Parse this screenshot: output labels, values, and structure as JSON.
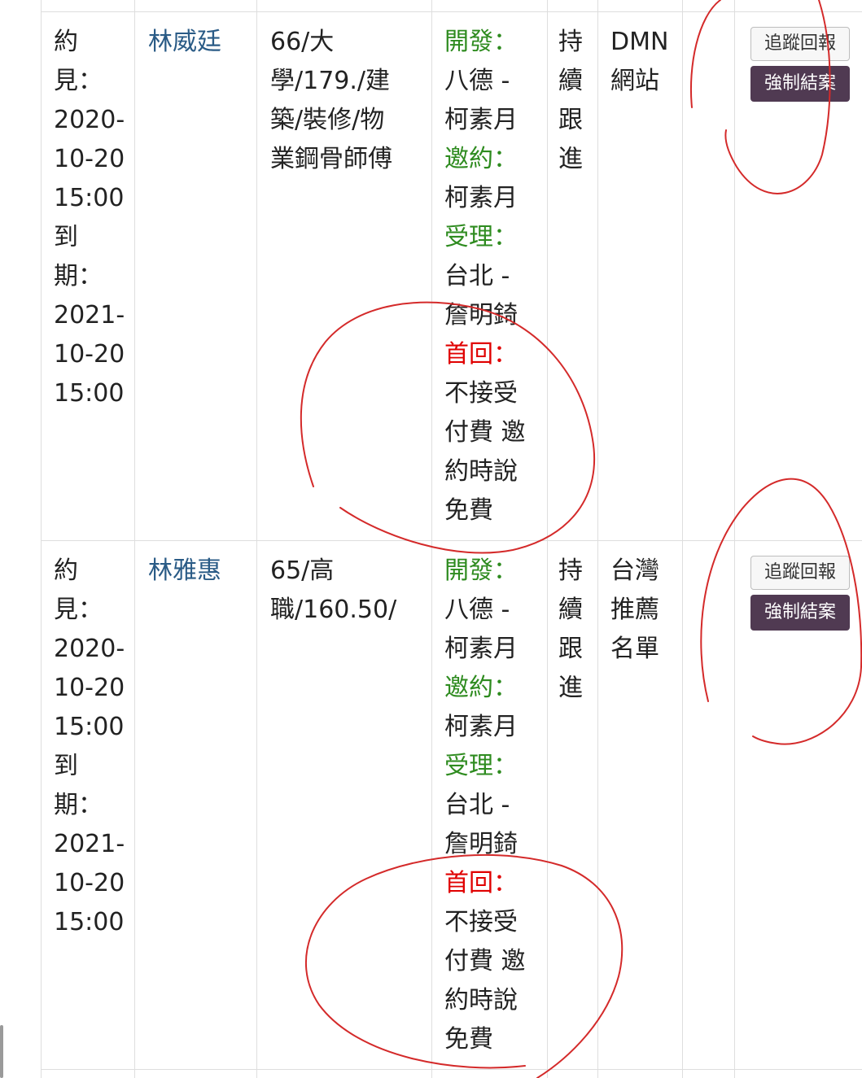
{
  "rows": [
    {
      "date_lines": [
        "約",
        "見：",
        "2020-",
        "10-20",
        "15:00",
        "到",
        "期：",
        "2021-",
        "10-20",
        "15:00"
      ],
      "name": "林威廷",
      "info_lines": [
        "66/大",
        "學/179./建",
        "築/裝修/物",
        "業鋼骨師傅"
      ],
      "staff": {
        "dev_label": "開發：",
        "dev_lines": [
          "八德 -",
          "柯素月"
        ],
        "invite_label": "邀約：",
        "invite_lines": [
          "柯素月"
        ],
        "accept_label": "受理：",
        "accept_lines": [
          "台北 -",
          "詹明錡"
        ],
        "reply_label": "首回：",
        "reply_lines": [
          "不接受",
          "付費 邀",
          "約時說",
          "免費"
        ]
      },
      "status_lines": [
        "持",
        "續",
        "跟",
        "進"
      ],
      "source_lines": [
        "DMN",
        "網站"
      ],
      "track_label": "追蹤回報",
      "force_label": "強制結案"
    },
    {
      "date_lines": [
        "約",
        "見：",
        "2020-",
        "10-20",
        "15:00",
        "到",
        "期：",
        "2021-",
        "10-20",
        "15:00"
      ],
      "name": "林雅惠",
      "info_lines": [
        "65/高",
        "職/160.50/"
      ],
      "staff": {
        "dev_label": "開發：",
        "dev_lines": [
          "八德 -",
          "柯素月"
        ],
        "invite_label": "邀約：",
        "invite_lines": [
          "柯素月"
        ],
        "accept_label": "受理：",
        "accept_lines": [
          "台北 -",
          "詹明錡"
        ],
        "reply_label": "首回：",
        "reply_lines": [
          "不接受",
          "付費 邀",
          "約時說",
          "免費"
        ]
      },
      "status_lines": [
        "持",
        "續",
        "跟",
        "進"
      ],
      "source_lines": [
        "台灣",
        "推薦",
        "名單"
      ],
      "track_label": "追蹤回報",
      "force_label": "強制結案"
    }
  ],
  "colors": {
    "label_green": "#2e8b1f",
    "label_red": "#e00000",
    "name_link": "#2a5b86",
    "force_button": "#503a52",
    "annotation_ink": "#d42a2a"
  }
}
